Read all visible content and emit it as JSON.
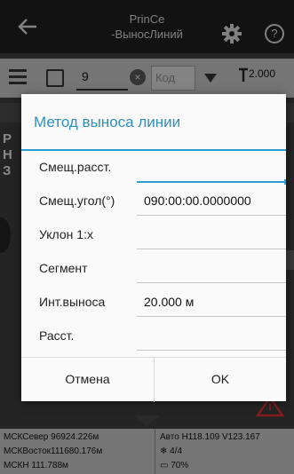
{
  "app": {
    "title_line1": "PrinCe",
    "title_line2": "-ВыносЛиний",
    "help_label": "?"
  },
  "toolbar": {
    "point_number": "9",
    "clear_label": "×",
    "code_placeholder": "Код",
    "rod_height": "2.000"
  },
  "background": {
    "side_letters": [
      "Р",
      "Н",
      "З"
    ]
  },
  "status": {
    "north": "МСКСевер  96924.226м",
    "east": "МСКВосток111680.176м",
    "height": "МСКН       111.788м",
    "solution": "Авто H118.109 V123.167",
    "satellites": "4/4",
    "battery": "70%"
  },
  "dialog": {
    "title": "Метод выноса линии",
    "fields": [
      {
        "label": "Смещ.расст.",
        "value": ""
      },
      {
        "label": "Смещ.угол(°)",
        "value": "090:00:00.0000000"
      },
      {
        "label": "Уклон 1:x",
        "value": ""
      },
      {
        "label": "Сегмент",
        "value": ""
      },
      {
        "label": "Инт.выноса",
        "value": "20.000 м"
      },
      {
        "label": "Расст.",
        "value": ""
      }
    ],
    "cancel_label": "Отмена",
    "ok_label": "OK"
  },
  "colors": {
    "accent": "#2f9fd0",
    "title_bar": "#1d1d1d",
    "toolbar": "#bdbdbd"
  }
}
